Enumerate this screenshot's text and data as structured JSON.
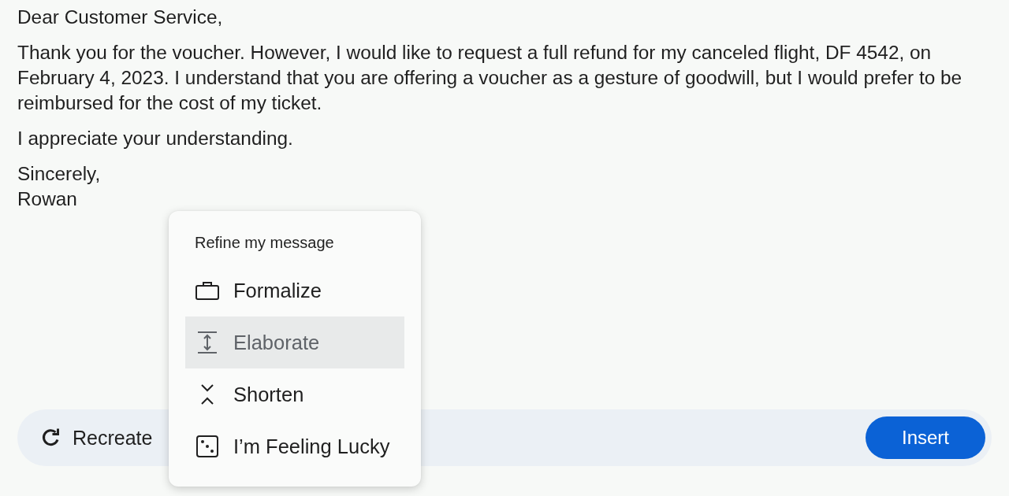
{
  "letter": {
    "greeting": "Dear Customer Service,",
    "paragraphs": [
      "Thank you for the voucher. However, I would like to request a full refund for my canceled flight, DF 4542, on February 4, 2023. I understand that you are offering a voucher as a gesture of goodwill, but I would prefer to be reimbursed for the cost of my ticket.",
      "I appreciate your understanding."
    ],
    "closing": "Sincerely,",
    "signature": "Rowan"
  },
  "action_bar": {
    "recreate_button": "Recreate",
    "insert_button": "Insert"
  },
  "refine_menu": {
    "title": "Refine my message",
    "items": [
      {
        "label": "Formalize",
        "selected": false
      },
      {
        "label": "Elaborate",
        "selected": true
      },
      {
        "label": "Shorten",
        "selected": false
      },
      {
        "label": "I’m Feeling Lucky",
        "selected": false
      }
    ]
  }
}
